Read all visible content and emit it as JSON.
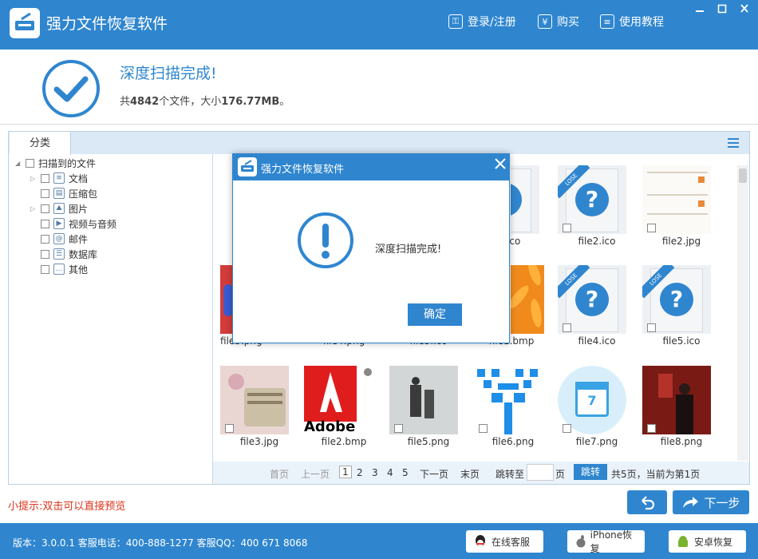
{
  "app": {
    "title": "强力文件恢复软件"
  },
  "header": {
    "login_label": "登录/注册",
    "buy_label": "购买",
    "tutorial_label": "使用教程"
  },
  "status": {
    "title": "深度扫描完成!",
    "summary_prefix": "共",
    "file_count": "4842",
    "summary_mid": "个文件，大小",
    "total_size": "176.77MB",
    "summary_suffix": "。"
  },
  "tabs": {
    "category": "分类"
  },
  "tree": {
    "root": "扫描到的文件",
    "items": [
      {
        "label": "文档",
        "icon": "document-icon",
        "expandable": true
      },
      {
        "label": "压缩包",
        "icon": "archive-icon",
        "expandable": false
      },
      {
        "label": "图片",
        "icon": "image-icon",
        "expandable": true
      },
      {
        "label": "视频与音频",
        "icon": "video-icon",
        "expandable": false
      },
      {
        "label": "邮件",
        "icon": "mail-icon",
        "expandable": false
      },
      {
        "label": "数据库",
        "icon": "database-icon",
        "expandable": false
      },
      {
        "label": "其他",
        "icon": "other-icon",
        "expandable": false
      }
    ]
  },
  "files": {
    "row1": [
      "1.ico",
      "file2.ico",
      "file2.jpg"
    ],
    "row2": [
      "file3.png",
      "file4.png",
      "file5.ico",
      "file1.bmp",
      "file4.ico",
      "file5.ico"
    ],
    "row3": [
      "file3.jpg",
      "file2.bmp",
      "file5.png",
      "file6.png",
      "file7.png",
      "file8.png"
    ]
  },
  "pager": {
    "first": "首页",
    "prev": "上一页",
    "pages": [
      "1",
      "2",
      "3",
      "4",
      "5"
    ],
    "next": "下一页",
    "last": "末页",
    "jump_to": "跳转至",
    "page_unit": "页",
    "jump_button": "跳转",
    "total_info": "共5页，当前为第1页"
  },
  "hint": "小提示:双击可以直接预览",
  "nav": {
    "next_label": "下一步"
  },
  "footer": {
    "info": "版本：3.0.0.1 客服电话：400-888-1277     客服QQ：400 671 8068",
    "online_service": "在线客服",
    "iphone_recovery": "iPhone恢复",
    "android_recovery": "安卓恢复"
  },
  "dialog": {
    "title": "强力文件恢复软件",
    "message": "深度扫描完成!",
    "ok_label": "确定"
  },
  "colors": {
    "primary": "#2f86cf",
    "hint_red": "#e0321a"
  }
}
